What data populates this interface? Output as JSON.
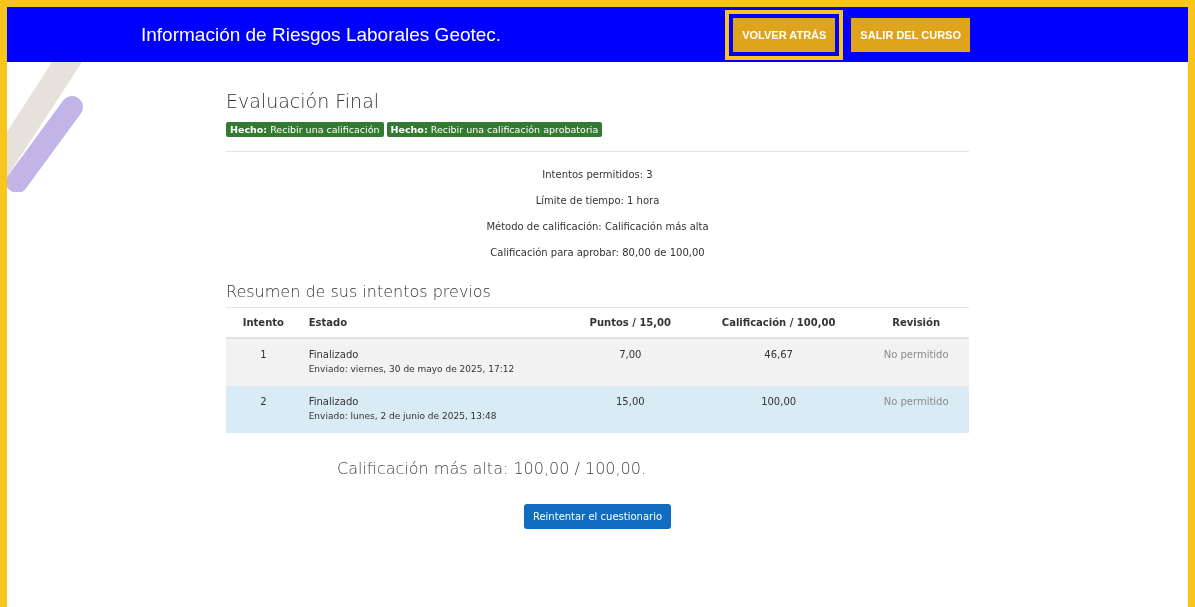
{
  "header": {
    "title": "Información de Riesgos Laborales Geotec.",
    "buttons": [
      {
        "label": "VOLVER ATRÁS",
        "focused": true
      },
      {
        "label": "SALIR DEL CURSO",
        "focused": false
      }
    ]
  },
  "activity": {
    "title": "Evaluación Final",
    "completion_badges": [
      "**Hecho:** Recibir una calificación",
      "**Hecho:** Recibir una calificación aprobatoria"
    ]
  },
  "quiz_info": [
    "Intentos permitidos: 3",
    "Límite de tiempo: 1 hora",
    "Método de calificación: Calificación más alta",
    "Calificación para aprobar: 80,00 de 100,00"
  ],
  "attempts": {
    "title": "Resumen de sus intentos previos",
    "columns": [
      "Intento",
      "Estado",
      "Puntos / 15,00",
      "Calificación / 100,00",
      "Revisión"
    ],
    "rows": [
      {
        "attempt": "1",
        "state": "Finalizado",
        "submitted": "Enviado: viernes, 30 de mayo de 2025, 17:12",
        "points": "7,00",
        "grade": "46,67",
        "review": "No permitido",
        "selected": false
      },
      {
        "attempt": "2",
        "state": "Finalizado",
        "submitted": "Enviado: lunes, 2 de junio de 2025, 13:48",
        "points": "15,00",
        "grade": "100,00",
        "review": "No permitido",
        "selected": true
      }
    ]
  },
  "highest_grade": "Calificación más alta: 100,00 / 100,00.",
  "retry_button": "Reintentar el cuestionario"
}
